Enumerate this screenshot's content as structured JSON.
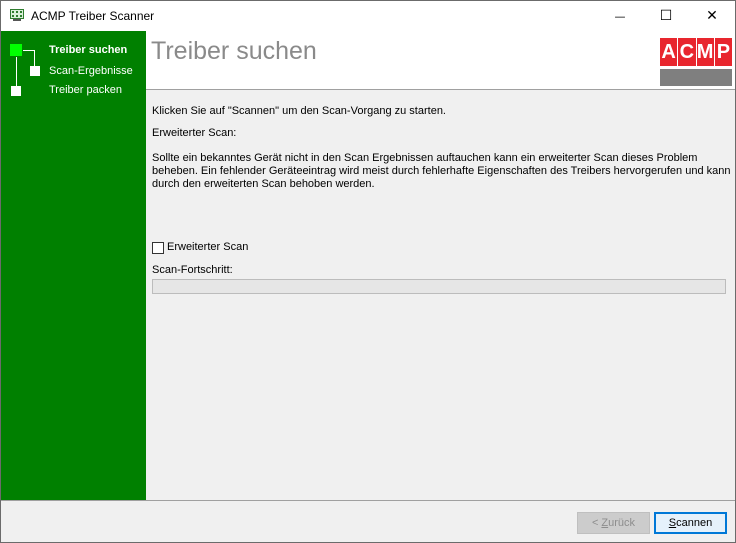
{
  "window": {
    "title": "ACMP Treiber Scanner",
    "controls": {
      "minimize": "—",
      "maximize": "☐",
      "close": "✕"
    },
    "icon": "app-scanner-icon"
  },
  "sidebar": {
    "color": "#008000",
    "active_color": "#00ff00",
    "steps": [
      {
        "label": "Treiber suchen",
        "active": true
      },
      {
        "label": "Scan-Ergebnisse",
        "active": false
      },
      {
        "label": "Treiber packen",
        "active": false
      }
    ]
  },
  "header": {
    "title": "Treiber suchen",
    "logo": {
      "letters": [
        "A",
        "C",
        "M",
        "P"
      ],
      "color": "#e8262e",
      "bar_color": "#7f7f7f"
    }
  },
  "main": {
    "intro": "Klicken Sie auf \"Scannen\" um den Scan-Vorgang zu starten.",
    "extended_heading": "Erweiterter Scan:",
    "extended_description": "Sollte ein bekanntes Gerät nicht in den Scan Ergebnissen auftauchen kann ein erweiterter Scan dieses Problem beheben. Ein fehlender Geräteeintrag wird meist durch fehlerhafte Eigenschaften des Treibers hervorgerufen und kann durch den erweiterten Scan behoben werden.",
    "checkbox_label": "Erweiterter Scan",
    "checkbox_checked": false,
    "progress_label": "Scan-Fortschritt:",
    "progress_value": 0
  },
  "footer": {
    "back_prefix": "< ",
    "back_accel": "Z",
    "back_rest": "urück",
    "back_enabled": false,
    "scan_accel": "S",
    "scan_rest": "cannen"
  }
}
